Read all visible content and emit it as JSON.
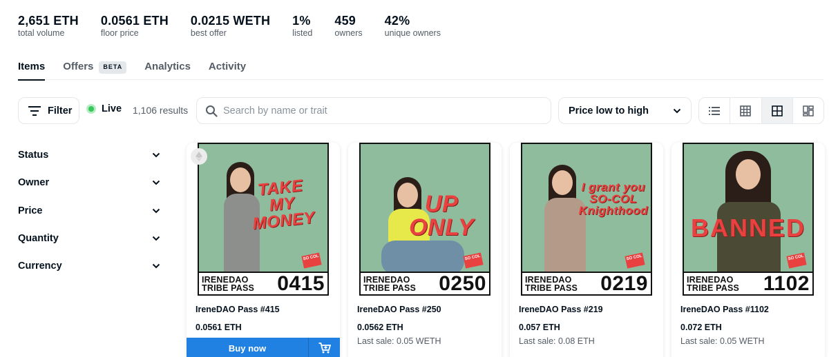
{
  "stats": [
    {
      "value": "2,651 ETH",
      "label": "total volume"
    },
    {
      "value": "0.0561 ETH",
      "label": "floor price"
    },
    {
      "value": "0.0215 WETH",
      "label": "best offer"
    },
    {
      "value": "1%",
      "label": "listed"
    },
    {
      "value": "459",
      "label": "owners"
    },
    {
      "value": "42%",
      "label": "unique owners"
    }
  ],
  "tabs": [
    {
      "label": "Items",
      "active": true
    },
    {
      "label": "Offers",
      "badge": "BETA"
    },
    {
      "label": "Analytics"
    },
    {
      "label": "Activity"
    }
  ],
  "toolbar": {
    "filter_label": "Filter",
    "live_label": "Live",
    "results": "1,106 results",
    "search_placeholder": "Search by name or trait",
    "sort_label": "Price low to high",
    "views": [
      "list-view-icon",
      "grid-large-icon",
      "grid-medium-icon",
      "grid-mosaic-icon"
    ],
    "active_view": 2
  },
  "sidebar": {
    "items": [
      {
        "label": "Status"
      },
      {
        "label": "Owner"
      },
      {
        "label": "Price"
      },
      {
        "label": "Quantity"
      },
      {
        "label": "Currency"
      }
    ]
  },
  "cards": [
    {
      "name": "IreneDAO Pass #415",
      "price": "0.0561 ETH",
      "last_sale": "",
      "buy_label": "Buy now",
      "art": {
        "slogan": "TAKE\nMY\nMONEY",
        "number": "0415",
        "band": "IRENEDAO\nTRIBE PASS",
        "badge": "SO\nCOL",
        "outfit": "#8c8f8c"
      }
    },
    {
      "name": "IreneDAO Pass #250",
      "price": "0.0562 ETH",
      "last_sale": "Last sale: 0.05 WETH",
      "art": {
        "slogan": "UP\nONLY",
        "number": "0250",
        "band": "IRENEDAO\nTRIBE PASS",
        "badge": "SO\nCOL",
        "outfit": "#e7e84a"
      }
    },
    {
      "name": "IreneDAO Pass #219",
      "price": "0.057 ETH",
      "last_sale": "Last sale: 0.08 ETH",
      "art": {
        "slogan": "I grant you\nSO-COL\nKnighthood",
        "number": "0219",
        "band": "IRENEDAO\nTRIBE PASS",
        "badge": "SO\nCOL",
        "outfit": "#b49a88"
      }
    },
    {
      "name": "IreneDAO Pass #1102",
      "price": "0.072 ETH",
      "last_sale": "Last sale: 0.05 WETH",
      "art": {
        "slogan": "BANNED",
        "number": "1102",
        "band": "IRENEDAO\nTRIBE PASS",
        "badge": "SO\nCOL",
        "outfit": "#4b4a34"
      }
    }
  ],
  "colors": {
    "accent": "#2081e2",
    "live": "#34c759",
    "art_bg": "#8fbc9d",
    "slogan": "#e8413f"
  }
}
